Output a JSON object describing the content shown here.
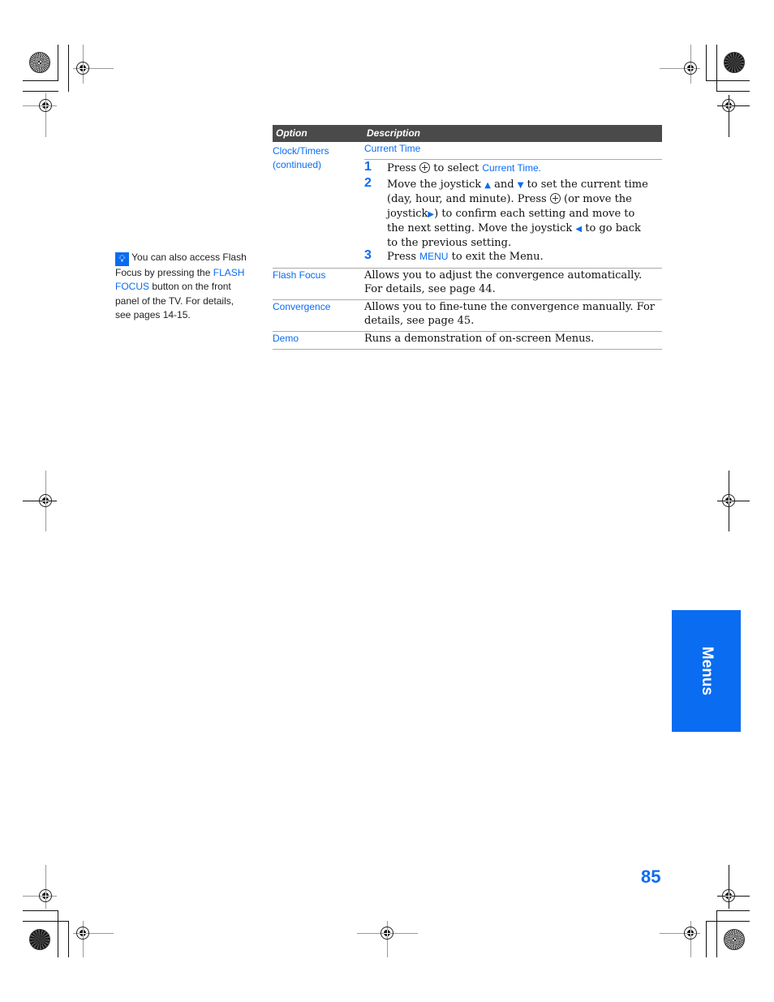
{
  "table": {
    "headers": {
      "option": "Option",
      "description": "Description"
    },
    "rows": [
      {
        "option_line1": "Clock/Timers",
        "option_line2": "(continued)",
        "subheading": "Current Time",
        "steps": [
          {
            "num": "1",
            "parts": [
              "Press",
              "to select",
              "Current Time."
            ]
          },
          {
            "num": "2",
            "parts": [
              "Move the joystick",
              "and",
              "to set the current time (day, hour, and minute). Press",
              "(or move the joystick",
              ") to confirm each setting and move to the next setting. Move the joystick",
              "to go back to the previous setting."
            ]
          },
          {
            "num": "3",
            "parts": [
              "Press",
              "MENU",
              "to exit the Menu."
            ]
          }
        ]
      },
      {
        "option": "Flash Focus",
        "description": "Allows you to adjust the convergence automatically. For details, see page 44."
      },
      {
        "option": "Convergence",
        "description": "Allows you to fine-tune the convergence manually. For details, see page 45."
      },
      {
        "option": "Demo",
        "description": "Runs a demonstration of on-screen Menus."
      }
    ]
  },
  "icons": {
    "joystick": "joystick-press-icon",
    "up": "▲",
    "down": "▼",
    "right": "▶",
    "left": "◀",
    "tip": "lightbulb-icon"
  },
  "tip": {
    "text1": "You can also access Flash Focus by pressing the",
    "highlight": "FLASH FOCUS",
    "text2": "button on the front panel of the TV. For details, see pages 14-15."
  },
  "side_tab": {
    "label": "Menus"
  },
  "page_number": "85",
  "colors": {
    "accent": "#0a6cf0",
    "header_bg": "#4a4a4a"
  }
}
